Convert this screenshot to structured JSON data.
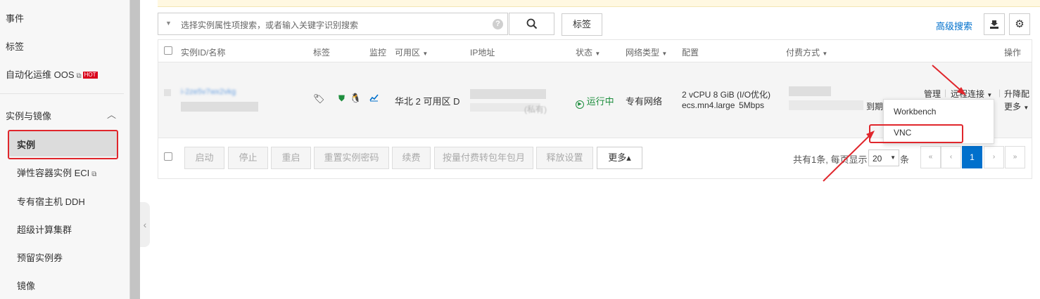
{
  "sidebar": {
    "items": [
      {
        "label": "事件"
      },
      {
        "label": "标签"
      },
      {
        "label": "自动化运维 OOS",
        "badge": "HOT"
      },
      {
        "label": "实例与镜像"
      },
      {
        "label": "实例"
      },
      {
        "label": "弹性容器实例 ECI"
      },
      {
        "label": "专有宿主机 DDH"
      },
      {
        "label": "超级计算集群"
      },
      {
        "label": "预留实例券"
      },
      {
        "label": "镜像"
      }
    ]
  },
  "toolbar": {
    "search_placeholder": "选择实例属性项搜索，或者输入关键字识别搜索",
    "help_icon": "?",
    "tag_button": "标签",
    "advanced_search": "高级搜索"
  },
  "table": {
    "headers": [
      "实例ID/名称",
      "标签",
      "监控",
      "可用区",
      "IP地址",
      "状态",
      "网络类型",
      "配置",
      "付费方式",
      "操作"
    ],
    "row": {
      "instance_id_visible": "i-2ze5v7wx2vkg",
      "zone": "华北 2 可用区 D",
      "ip_suffix": "(私有)",
      "status": "运行中",
      "network": "专有网络",
      "config_line1": "2 vCPU 8 GiB (I/O优化)",
      "config_type": "ecs.mn4.large",
      "bandwidth": "5Mbps",
      "billing_suffix": "到期",
      "actions": {
        "manage": "管理",
        "remote": "远程连接",
        "upgrade": "升降配",
        "more": "更多"
      }
    }
  },
  "remote_menu": {
    "items": [
      "Workbench",
      "VNC"
    ]
  },
  "bulk_actions": {
    "buttons": [
      "启动",
      "停止",
      "重启",
      "重置实例密码",
      "续费",
      "按量付费转包年包月",
      "释放设置"
    ],
    "more": "更多▴"
  },
  "pagination": {
    "summary_prefix": "共有1条, 每页显示",
    "page_size": "20",
    "summary_suffix": "条",
    "first": "«",
    "prev": "‹",
    "current": "1",
    "next": "›",
    "last": "»"
  },
  "colors": {
    "link": "#0070cc",
    "running": "#1e8e3e",
    "annotation": "#e0262c",
    "hot_badge": "#d9001b"
  }
}
